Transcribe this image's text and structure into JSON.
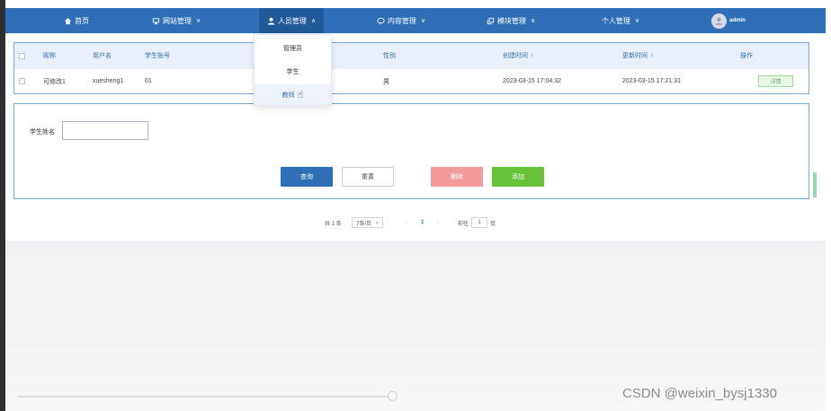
{
  "nav": {
    "home": "首页",
    "site_mgmt": "网站管理",
    "people_mgmt": "人员管理",
    "content_mgmt": "内容管理",
    "module_mgmt": "模块管理",
    "personal_mgmt": "个人管理",
    "user": "admin"
  },
  "dropdown": {
    "items": [
      "管理员",
      "学生",
      "教师"
    ],
    "hover_index": 2
  },
  "table": {
    "headers": [
      "昵称",
      "用户名",
      "学生账号",
      "性别",
      "创建时间",
      "更新时间",
      "操作"
    ],
    "rows": [
      {
        "nickname": "可修改1",
        "username": "xuesheng1",
        "account": "01",
        "gender": "男",
        "created": "2023-03-15 17:04:32",
        "updated": "2023-03-15 17:21:31",
        "action": "详情"
      }
    ]
  },
  "search": {
    "label": "学生姓名",
    "value": "",
    "buttons": {
      "query": "查询",
      "reset": "重置",
      "delete": "删除",
      "add": "添加"
    }
  },
  "pagination": {
    "total": "共 1 条",
    "page_size": "7条/页",
    "prev": "‹",
    "current": "1",
    "next": "›",
    "goto_label": "前往",
    "goto_value": "1",
    "page_suffix": "页"
  },
  "watermark": "CSDN @weixin_bysj1330",
  "colors": {
    "nav": "#2f6fb8",
    "nav_active": "#22599a",
    "query": "#2f6fb8",
    "delete": "#f59a9a",
    "add": "#67c23a"
  }
}
